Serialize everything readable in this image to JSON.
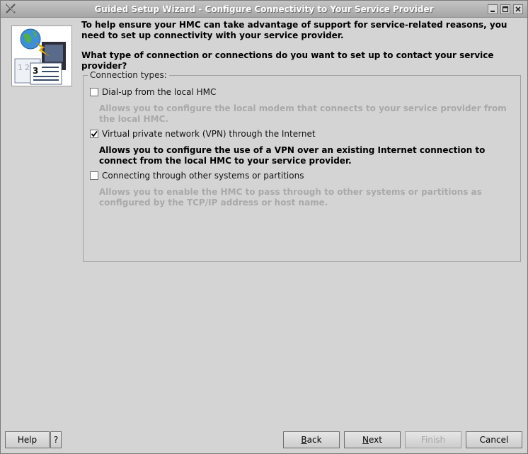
{
  "window": {
    "title": "Guided Setup Wizard - Configure Connectivity to Your Service Provider",
    "controls": [
      "minimize-icon",
      "maximize-icon",
      "close-icon"
    ]
  },
  "header": {
    "intro": "To help ensure your HMC can take advantage of support for service-related reasons, you need to set up connectivity with your service provider.",
    "question": "What type of connection or connections do you want to set up to contact your service provider?",
    "step_number": "3"
  },
  "group": {
    "legend": "Connection types:",
    "options": [
      {
        "label": "Dial-up from the local HMC",
        "checked": false,
        "description": "Allows you to configure the local modem that connects to your service provider from the local HMC.",
        "description_enabled": false
      },
      {
        "label": "Virtual private network (VPN) through the Internet",
        "checked": true,
        "description": "Allows you to configure the use of a VPN over an existing Internet connection to connect from the local HMC to your service provider.",
        "description_enabled": true
      },
      {
        "label": "Connecting through other systems or partitions",
        "checked": false,
        "description": "Allows you to enable the HMC to pass through to other systems or partitions as configured by the TCP/IP address or host name.",
        "description_enabled": false
      }
    ]
  },
  "footer": {
    "help": "Help",
    "help_question": "?",
    "back_pre": "",
    "back_mn": "B",
    "back_post": "ack",
    "next_pre": "",
    "next_mn": "N",
    "next_post": "ext",
    "finish": "Finish",
    "cancel": "Cancel"
  },
  "colors": {
    "window_bg": "#d4d4d4",
    "titlebar": "#b4b4b4",
    "disabled_text": "#a9a9a9"
  }
}
